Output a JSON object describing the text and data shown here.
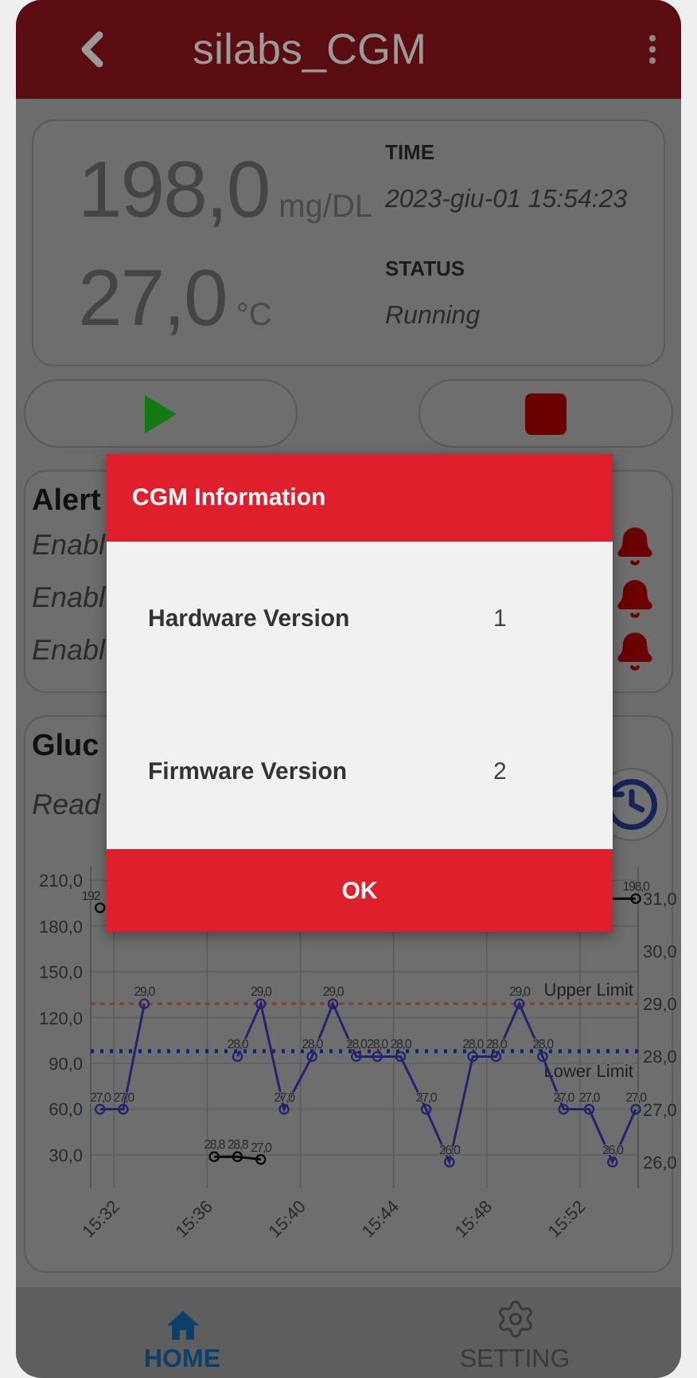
{
  "app_bar": {
    "title": "silabs_CGM"
  },
  "reading": {
    "glucose": "198,0",
    "glucose_unit": "mg/DL",
    "temperature": "27,0",
    "temperature_unit": "°C",
    "time_label": "TIME",
    "time": "2023-giu-01 15:54:23",
    "status_label": "STATUS",
    "status": "Running"
  },
  "controls": [
    {
      "kind": "play"
    },
    {
      "kind": "stop"
    }
  ],
  "alerts": {
    "title": "Alert",
    "rows": [
      {
        "text": "Enabl"
      },
      {
        "text": "Enabl"
      },
      {
        "text": "Enabl"
      }
    ]
  },
  "glucose": {
    "title": "Gluc",
    "subtitle": "Read",
    "chart_data": {
      "type": "line",
      "grid": true,
      "x": [
        931.4,
        932.4,
        933.3,
        936.3,
        937.3,
        938.3,
        939.3,
        940.5,
        941.4,
        942.4,
        943.3,
        944.3,
        945.4,
        946.4,
        947.4,
        948.4,
        949.4,
        950.4,
        951.3,
        952.4,
        953.4,
        954.4
      ],
      "xlim": [
        931,
        954.5
      ],
      "xticks": [
        {
          "value": 932,
          "label": "15:32"
        },
        {
          "value": 936,
          "label": "15:36"
        },
        {
          "value": 940,
          "label": "15:40"
        },
        {
          "value": 944,
          "label": "15:44"
        },
        {
          "value": 948,
          "label": "15:48"
        },
        {
          "value": 952,
          "label": "15:52"
        }
      ],
      "ylim": [
        8,
        219
      ],
      "yticks": [
        {
          "value": 30,
          "label": "30,0"
        },
        {
          "value": 60,
          "label": "60,0"
        },
        {
          "value": 90,
          "label": "90,0"
        },
        {
          "value": 120,
          "label": "120,0"
        },
        {
          "value": 150,
          "label": "150,0"
        },
        {
          "value": 180,
          "label": "180,0"
        },
        {
          "value": 210,
          "label": "210,0"
        }
      ],
      "y2lim": [
        25.5,
        31.6
      ],
      "y2ticks": [
        {
          "value": 26,
          "label": "26,0"
        },
        {
          "value": 27,
          "label": "27,0"
        },
        {
          "value": 28,
          "label": "28,0"
        },
        {
          "value": 29,
          "label": "29,0"
        },
        {
          "value": 30,
          "label": "30,0"
        },
        {
          "value": 31,
          "label": "31,0"
        }
      ],
      "series": [
        {
          "color": "#0a0a0a",
          "marker": "circle",
          "values": [
            192,
            null,
            null,
            28.8,
            28.8,
            27,
            null,
            null,
            null,
            null,
            null,
            null,
            null,
            null,
            null,
            null,
            null,
            null,
            null,
            null,
            198,
            198
          ],
          "value_labels": [
            "192",
            null,
            null,
            "28,8",
            "28,8",
            "27,0",
            null,
            null,
            null,
            null,
            null,
            null,
            null,
            null,
            null,
            null,
            null,
            null,
            null,
            null,
            null,
            "198,0"
          ]
        },
        {
          "color": "#24246e",
          "axis": "y2",
          "marker": "circle",
          "values": [
            27,
            27,
            29,
            null,
            28,
            29,
            27,
            28,
            29,
            28,
            28,
            28,
            27,
            26,
            28,
            28,
            29,
            28,
            27,
            27,
            26,
            27
          ],
          "value_labels": [
            "27,0",
            "27,0",
            "29,0",
            null,
            "28,0",
            "29,0",
            "27,0",
            "28,0",
            "29,0",
            "28,0",
            "28,0",
            "28,0",
            "27,0",
            "26,0",
            "28,0",
            "28,0",
            "29,0",
            "28,0",
            "27,0",
            "27,0",
            "26,0",
            "27,0"
          ]
        }
      ],
      "ref_lines": [
        {
          "value": 29,
          "axis": "y2",
          "label": "Upper Limit",
          "color": "#8a3a3a"
        },
        {
          "value": 28.1,
          "axis": "y2",
          "label": "Lower Limit",
          "color": "#1c1c80"
        }
      ]
    }
  },
  "dialog": {
    "title": "CGM Information",
    "rows": [
      {
        "label": "Hardware Version",
        "value": "1"
      },
      {
        "label": "Firmware Version",
        "value": "2"
      }
    ],
    "button": "OK"
  },
  "bottom_nav": [
    {
      "label": "HOME",
      "kind": "home",
      "selected": true
    },
    {
      "label": "SETTING",
      "kind": "gear",
      "selected": false
    }
  ]
}
